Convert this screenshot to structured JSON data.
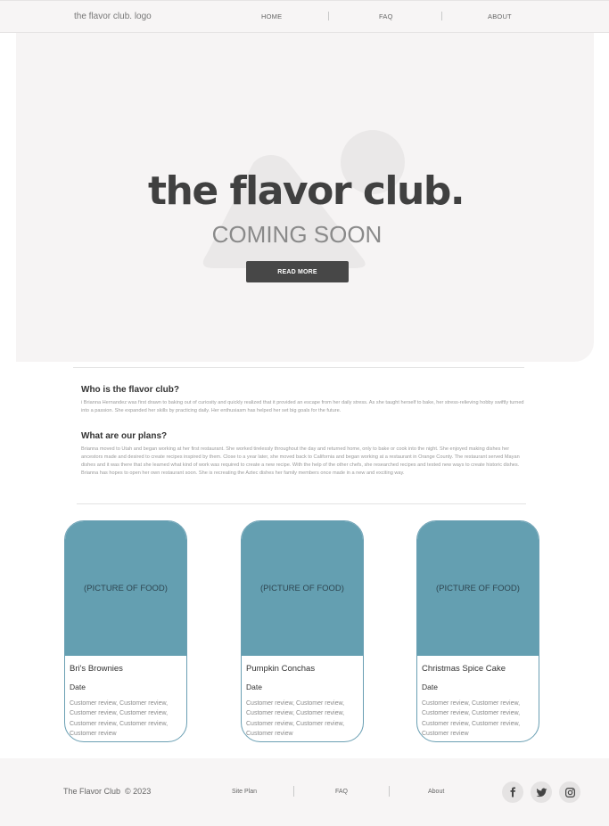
{
  "nav": {
    "logo": "the flavor club. logo",
    "links": [
      "HOME",
      "FAQ",
      "ABOUT"
    ]
  },
  "hero": {
    "title": "the flavor club.",
    "subtitle": "COMING SOON",
    "button_label": "READ MORE"
  },
  "about": {
    "sections": [
      {
        "heading": "Who is the flavor club?",
        "body": "i Brianna Hernandez was first drawn to baking out of curiosity and quickly realized that it provided an escape from her daily stress. As she taught herself to bake, her stress-relieving hobby swiftly turned into a passion. She expanded her skills by practicing daily. Her enthusiasm has helped her set big goals for the future."
      },
      {
        "heading": "What are our plans?",
        "body": "Brianna moved to Utah and began working at her first restaurant. She worked tirelessly throughout the day and returned home, only to bake or cook into the night. She enjoyed making dishes her ancestors made and desired to create recipes inspired by them. Close to a year later, she moved back to California and began working at a restaurant in Orange County. The restaurant served Mayan dishes and it was there that she learned what kind of work was required to create a new recipe. With the help of the other chefs, she researched recipes and tested new ways to create historic dishes. Brianna has hopes to open her own restaurant soon. She is recreating the Aztec dishes her family members once made in a new and exciting way."
      }
    ]
  },
  "cards": [
    {
      "image_label": "(PICTURE OF FOOD)",
      "title": "Bri's Brownies",
      "date": "Date",
      "review": "Customer review, Customer review, Customer review, Customer review, Customer review, Customer review, Customer review"
    },
    {
      "image_label": "(PICTURE OF FOOD)",
      "title": "Pumpkin Conchas",
      "date": "Date",
      "review": "Customer review, Customer review, Customer review, Customer review, Customer review, Customer review, Customer review"
    },
    {
      "image_label": "(PICTURE OF FOOD)",
      "title": "Christmas Spice Cake",
      "date": "Date",
      "review": "Customer review, Customer review, Customer review, Customer review, Customer review, Customer review, Customer review"
    }
  ],
  "footer": {
    "brand": "The Flavor Club",
    "copyright": "© 2023",
    "links": [
      "Site Plan",
      "FAQ",
      "About"
    ],
    "social_icons": [
      "facebook-icon",
      "twitter-icon",
      "instagram-icon"
    ]
  },
  "colors": {
    "accent": "#649fb1",
    "button": "#474747",
    "background": "#f6f4f4"
  }
}
